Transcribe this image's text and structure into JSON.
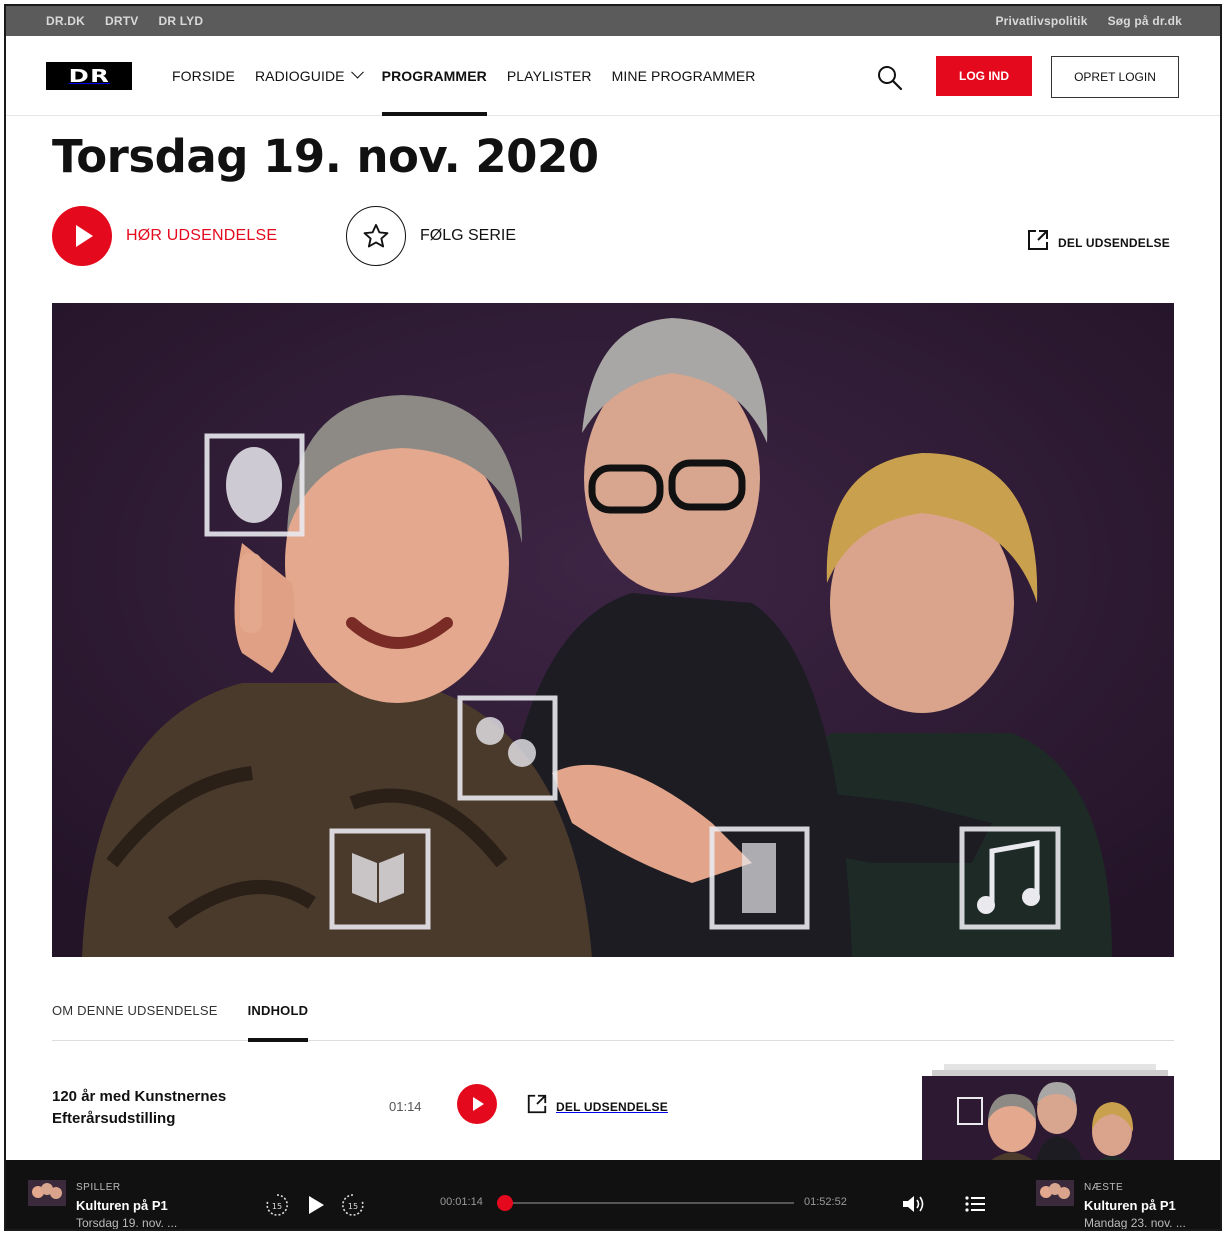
{
  "utility_bar": {
    "left_links": [
      "DR.DK",
      "DRTV",
      "DR LYD"
    ],
    "right_links": [
      "Privatlivspolitik",
      "Søg på dr.dk"
    ]
  },
  "nav": {
    "logo_text": "DR",
    "items": [
      {
        "label": "FORSIDE"
      },
      {
        "label": "RADIOGUIDE"
      },
      {
        "label": "PROGRAMMER"
      },
      {
        "label": "PLAYLISTER"
      },
      {
        "label": "MINE PROGRAMMER"
      }
    ],
    "active_item": "PROGRAMMER",
    "login_label": "LOG IND",
    "create_login_label": "OPRET LOGIN",
    "search_icon": "search-icon"
  },
  "episode": {
    "title": "Torsdag 19. nov. 2020",
    "listen_label": "HØR UDSENDELSE",
    "follow_label": "FØLG SERIE",
    "share_label": "DEL UDSENDELSE"
  },
  "tabs": [
    {
      "label": "OM DENNE UDSENDELSE"
    },
    {
      "label": "INDHOLD"
    }
  ],
  "active_tab": "INDHOLD",
  "content_items": [
    {
      "title": "120 år med Kunstnernes Efterårsudstilling",
      "time": "01:14",
      "share_label": "DEL UDSENDELSE"
    }
  ],
  "player": {
    "now": {
      "label": "SPILLER",
      "title": "Kulturen på P1",
      "subtitle": "Torsdag 19. nov. ..."
    },
    "elapsed": "00:01:14",
    "duration": "01:52:52",
    "progress": 0.011,
    "skip_back_label": "15",
    "skip_forward_label": "15",
    "next": {
      "label": "NÆSTE",
      "title": "Kulturen på P1",
      "subtitle": "Mandag 23. nov. ..."
    }
  },
  "colors": {
    "brand_red": "#e5091e",
    "utility_bar_bg": "#5b5b5b",
    "player_bg": "#111111",
    "hero_bg": "#2d1a32"
  }
}
